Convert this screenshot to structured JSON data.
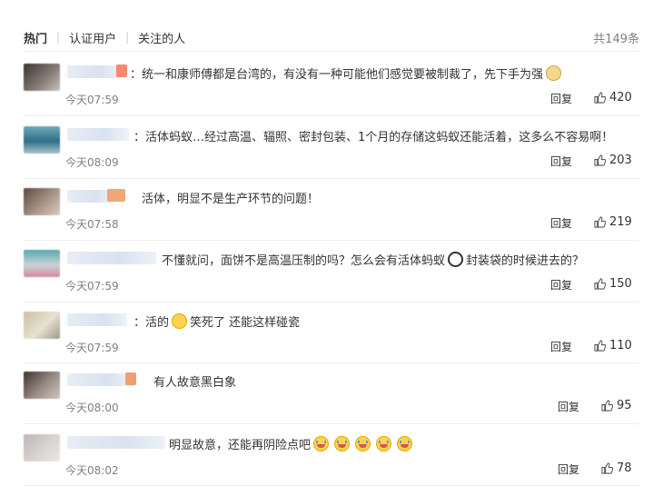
{
  "tabs": [
    {
      "label": "热门"
    },
    {
      "label": "认证用户"
    },
    {
      "label": "关注的人"
    }
  ],
  "total_label": "共149条",
  "reply_label": "回复",
  "comments": [
    {
      "text": "：统一和康师傅都是台湾的，有没有一种可能他们感觉要被制裁了，先下手为强",
      "time": "今天07:59",
      "likes": "420",
      "emoji_after": "doge-icon"
    },
    {
      "text": "：活体蚂蚁…经过高温、辐照、密封包装、1个月的存储这蚂蚁还能活着，这多么不容易啊！",
      "time": "今天08:09",
      "likes": "203"
    },
    {
      "text": "活体，明显不是生产环节的问题！",
      "time": "今天07:58",
      "likes": "219"
    },
    {
      "text_a": "不懂就问，面饼不是高温压制的吗？怎么会有活体蚂蚁",
      "text_b": "封装袋的时候进去的？",
      "time": "今天07:59",
      "likes": "150"
    },
    {
      "text_a": "：活的",
      "text_b": "笑死了 还能这样碰瓷",
      "time": "今天07:59",
      "likes": "110"
    },
    {
      "text": "有人故意黑白象",
      "time": "今天08:00",
      "likes": "95"
    },
    {
      "text": "明显故意，还能再阴险点吧",
      "time": "今天08:02",
      "likes": "78"
    }
  ],
  "colors": {
    "accent_orange": "#f0a070",
    "nick_blue": "#d9e2ef",
    "text": "#333333",
    "muted": "#808080"
  }
}
